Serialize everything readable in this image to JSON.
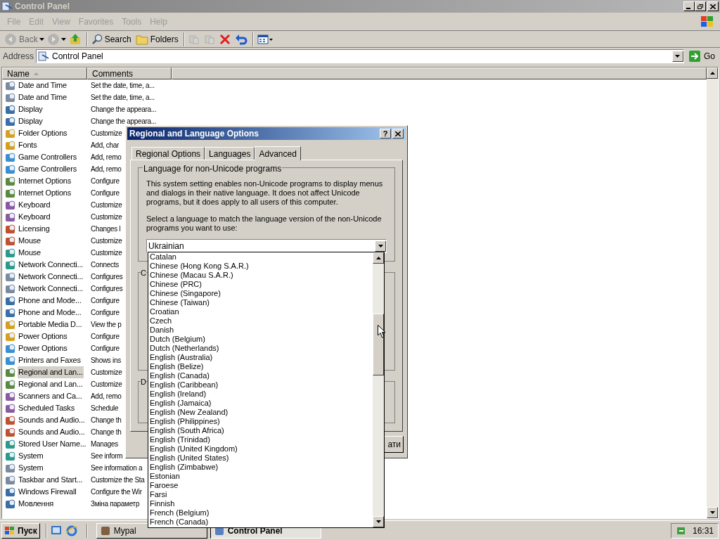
{
  "window": {
    "title": "Control Panel"
  },
  "menu": [
    "File",
    "Edit",
    "View",
    "Favorites",
    "Tools",
    "Help"
  ],
  "toolbar": [
    {
      "kind": "back",
      "label": "Back",
      "disabled": true
    },
    {
      "kind": "forward",
      "disabled": true
    },
    {
      "kind": "up",
      "disabled": false
    },
    {
      "kind": "search",
      "label": "Search",
      "disabled": false
    },
    {
      "kind": "folders",
      "label": "Folders",
      "disabled": false
    },
    {
      "kind": "move",
      "disabled": true
    },
    {
      "kind": "copy",
      "disabled": true
    },
    {
      "kind": "delete",
      "disabled": false
    },
    {
      "kind": "undo",
      "disabled": false
    },
    {
      "kind": "views",
      "disabled": false
    }
  ],
  "address": {
    "label": "Address",
    "value": "Control Panel",
    "go": "Go"
  },
  "columns": [
    {
      "label": "Name",
      "sorted": true
    },
    {
      "label": "Comments",
      "sorted": false
    }
  ],
  "rows": [
    {
      "name": "Date and Time",
      "comment": "Set the date, time, a...",
      "selected": false
    },
    {
      "name": "Date and Time",
      "comment": "Set the date, time, a...",
      "selected": false
    },
    {
      "name": "Display",
      "comment": "Change the appeara...",
      "selected": false
    },
    {
      "name": "Display",
      "comment": "Change the appeara...",
      "selected": false
    },
    {
      "name": "Folder Options",
      "comment": "Customize",
      "selected": false
    },
    {
      "name": "Fonts",
      "comment": "Add, char",
      "selected": false
    },
    {
      "name": "Game Controllers",
      "comment": "Add, remo",
      "selected": false
    },
    {
      "name": "Game Controllers",
      "comment": "Add, remo",
      "selected": false
    },
    {
      "name": "Internet Options",
      "comment": "Configure",
      "selected": false
    },
    {
      "name": "Internet Options",
      "comment": "Configure",
      "selected": false
    },
    {
      "name": "Keyboard",
      "comment": "Customize",
      "selected": false
    },
    {
      "name": "Keyboard",
      "comment": "Customize",
      "selected": false
    },
    {
      "name": "Licensing",
      "comment": "Changes l",
      "selected": false
    },
    {
      "name": "Mouse",
      "comment": "Customize",
      "selected": false
    },
    {
      "name": "Mouse",
      "comment": "Customize",
      "selected": false
    },
    {
      "name": "Network Connecti...",
      "comment": "Connects",
      "selected": false
    },
    {
      "name": "Network Connecti...",
      "comment": "Configures",
      "selected": false
    },
    {
      "name": "Network Connecti...",
      "comment": "Configures",
      "selected": false
    },
    {
      "name": "Phone and Mode...",
      "comment": "Configure",
      "selected": false
    },
    {
      "name": "Phone and Mode...",
      "comment": "Configure",
      "selected": false
    },
    {
      "name": "Portable Media D...",
      "comment": "View the p",
      "selected": false
    },
    {
      "name": "Power Options",
      "comment": "Configure",
      "selected": false
    },
    {
      "name": "Power Options",
      "comment": "Configure",
      "selected": false
    },
    {
      "name": "Printers and Faxes",
      "comment": "Shows ins",
      "selected": false
    },
    {
      "name": "Regional and Lan...",
      "comment": "Customize",
      "selected": true
    },
    {
      "name": "Regional and Lan...",
      "comment": "Customize",
      "selected": false
    },
    {
      "name": "Scanners and Ca...",
      "comment": "Add, remo",
      "selected": false
    },
    {
      "name": "Scheduled Tasks",
      "comment": "Schedule",
      "selected": false
    },
    {
      "name": "Sounds and Audio...",
      "comment": "Change th",
      "selected": false
    },
    {
      "name": "Sounds and Audio...",
      "comment": "Change th",
      "selected": false
    },
    {
      "name": "Stored User Name...",
      "comment": "Manages",
      "selected": false
    },
    {
      "name": "System",
      "comment": "See inform",
      "selected": false
    },
    {
      "name": "System",
      "comment": "See information a",
      "selected": false
    },
    {
      "name": "Taskbar and Start...",
      "comment": "Customize the Sta",
      "selected": false
    },
    {
      "name": "Windows Firewall",
      "comment": "Configure the Wir",
      "selected": false
    },
    {
      "name": "Мовлення",
      "comment": "Зміна параметр",
      "selected": false
    }
  ],
  "dialog": {
    "title": "Regional and Language Options",
    "help": "?",
    "tabs": [
      {
        "label": "Regional Options",
        "selected": false
      },
      {
        "label": "Languages",
        "selected": false
      },
      {
        "label": "Advanced",
        "selected": true
      }
    ],
    "group": {
      "label": "Language for non-Unicode programs",
      "description": "This system setting enables non-Unicode programs to display menus and dialogs in their native language. It does not affect Unicode programs, but it does apply to all users of this computer.",
      "instruction": "Select a language to match the language version of the non-Unicode programs you want to use:",
      "value": "Ukrainian"
    },
    "other_groups": [
      "C",
      "D"
    ],
    "button": "ати",
    "dropdown": [
      "Catalan",
      "Chinese (Hong Kong S.A.R.)",
      "Chinese (Macau S.A.R.)",
      "Chinese (PRC)",
      "Chinese (Singapore)",
      "Chinese (Taiwan)",
      "Croatian",
      "Czech",
      "Danish",
      "Dutch (Belgium)",
      "Dutch (Netherlands)",
      "English (Australia)",
      "English (Belize)",
      "English (Canada)",
      "English (Caribbean)",
      "English (Ireland)",
      "English (Jamaica)",
      "English (New Zealand)",
      "English (Philippines)",
      "English (South Africa)",
      "English (Trinidad)",
      "English (United Kingdom)",
      "English (United States)",
      "English (Zimbabwe)",
      "Estonian",
      "Faroese",
      "Farsi",
      "Finnish",
      "French (Belgium)",
      "French (Canada)"
    ]
  },
  "taskbar": {
    "start": "Пуск",
    "tasks": [
      {
        "label": "Mypal",
        "selected": false
      },
      {
        "label": "Control Panel",
        "selected": true
      }
    ],
    "clock": "16:31"
  }
}
